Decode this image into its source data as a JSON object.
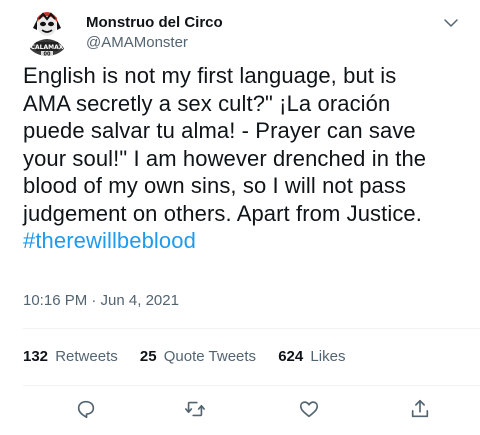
{
  "author": {
    "display_name": "Monstruo del Circo",
    "handle": "@AMAMonster",
    "avatar_icon": "masked-wrestler-avatar",
    "avatar_text": "CALAMAX"
  },
  "tweet": {
    "lines": [
      "English is not my first language, but is",
      "AMA secretly a sex cult?\" ¡La oración",
      "puede salvar tu alma! - Prayer can save",
      "your soul!\" I am however drenched in the",
      "blood of my own sins, so I will not pass",
      "judgement on others. Apart from Justice."
    ],
    "hashtag": "#therewillbeblood",
    "timestamp": "10:16 PM · Jun 4, 2021"
  },
  "stats": {
    "retweets_count": "132",
    "retweets_label": "Retweets",
    "quotes_count": "25",
    "quotes_label": "Quote Tweets",
    "likes_count": "624",
    "likes_label": "Likes"
  },
  "actions": [
    "reply-icon",
    "retweet-icon",
    "like-icon",
    "share-icon"
  ],
  "colors": {
    "text": "#0f1419",
    "secondary": "#536471",
    "link": "#1d9bf0",
    "divider": "#eff3f4"
  }
}
